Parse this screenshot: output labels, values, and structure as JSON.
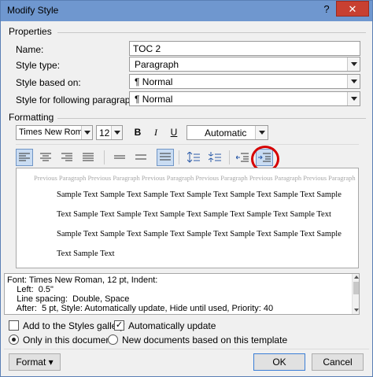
{
  "window": {
    "title": "Modify Style",
    "help_glyph": "?",
    "close_glyph": "✕"
  },
  "properties": {
    "section_label": "Properties",
    "name_label": "Name:",
    "name_value": "TOC 2",
    "style_type_label": "Style type:",
    "style_type_value": "Paragraph",
    "based_on_label": "Style based on:",
    "based_on_value": "¶  Normal",
    "following_label": "Style for following paragraph:",
    "following_value": "¶  Normal"
  },
  "formatting": {
    "section_label": "Formatting",
    "font_value": "Times New Roman",
    "size_value": "12",
    "bold_label": "B",
    "italic_label": "I",
    "underline_label": "U",
    "color_value": "Automatic"
  },
  "preview": {
    "previous_text": "Previous Paragraph Previous Paragraph Previous Paragraph Previous Paragraph Previous Paragraph Previous Paragraph Previous Paragraph Previous Paragraph Previous Paragraph Previous Paragraph Previous Paragraph Previous Paragraph",
    "sample_lines": [
      "Sample Text Sample Text Sample Text Sample Text Sample Text Sample Text Sample",
      "Text Sample Text Sample Text Sample Text Sample Text Sample Text Sample Text",
      "Sample Text Sample Text Sample Text Sample Text Sample Text Sample Text Sample",
      "Text Sample Text"
    ]
  },
  "description": {
    "lines": [
      "Font: Times New Roman, 12 pt, Indent:",
      "    Left:  0.5\"",
      "    Line spacing:  Double, Space",
      "    After:  5 pt, Style: Automatically update, Hide until used, Priority: 40"
    ]
  },
  "options": {
    "add_gallery_label": "Add to the Styles gallery",
    "auto_update_label": "Automatically update",
    "auto_update_check": "✓",
    "only_doc_label": "Only in this document",
    "new_docs_label": "New documents based on this template"
  },
  "buttons": {
    "format_label": "Format ▾",
    "ok_label": "OK",
    "cancel_label": "Cancel"
  },
  "colors": {
    "titlebar": "#6f97cf",
    "close": "#c84031",
    "highlight_circle": "#d60000"
  }
}
